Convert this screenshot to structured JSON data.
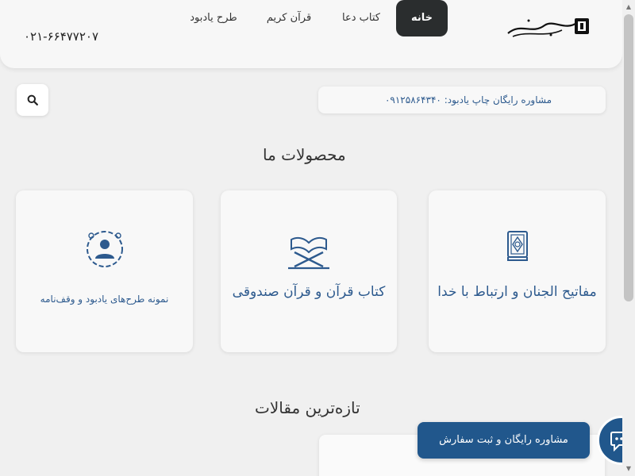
{
  "header": {
    "phone": "۰۲۱-۶۶۴۷۷۲۰۷",
    "nav": [
      {
        "label": "خانه",
        "active": true
      },
      {
        "label": "کتاب دعا",
        "active": false
      },
      {
        "label": "قرآن کریم",
        "active": false
      },
      {
        "label": "طرح یادبود",
        "active": false
      }
    ],
    "logo_text": "انتشارات کتاب اعمال"
  },
  "consult": {
    "text": "مشاوره رایگان چاپ یادبود: ۰۹۱۲۵۸۶۴۳۴۰"
  },
  "products": {
    "title": "محصولات ما",
    "items": [
      {
        "label": "مفاتیح الجنان و ارتباط با خدا",
        "icon": "book-icon"
      },
      {
        "label": "کتاب قرآن و قرآن صندوقی",
        "icon": "quran-stand-icon"
      },
      {
        "label": "نمونه طرح‌های یادبود و وقف‌نامه",
        "icon": "user-wreath-icon"
      }
    ]
  },
  "articles": {
    "title": "تازه‌ترین مقالات"
  },
  "cta": {
    "label": "مشاوره رایگان و ثبت سفارش"
  },
  "colors": {
    "accent": "#21578c",
    "nav_active": "#2a2d2e",
    "link": "#2d5a8e"
  }
}
